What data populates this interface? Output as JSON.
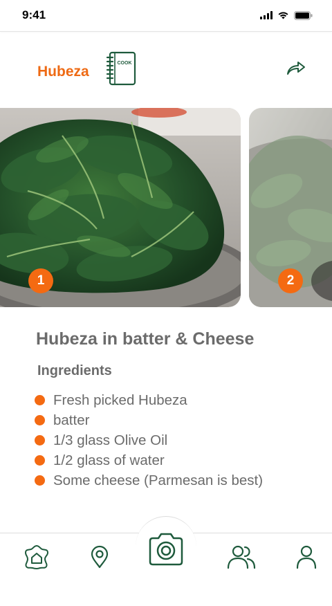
{
  "status_bar": {
    "time": "9:41",
    "icons": [
      "signal-icon",
      "wifi-icon",
      "battery-icon"
    ]
  },
  "header": {
    "title": "Hubeza",
    "cookbook_label": "COOK",
    "share_icon": "share-icon"
  },
  "carousel": {
    "slides": [
      {
        "badge": "1",
        "image": "boiled hubeza leaves in colander"
      },
      {
        "badge": "2",
        "image": "hubeza leaves boiling in pot"
      }
    ]
  },
  "recipe": {
    "title": "Hubeza in batter & Cheese",
    "section_heading": "Ingredients",
    "ingredients": [
      "Fresh picked Hubeza",
      "batter",
      "1/3 glass Olive Oil",
      "1/2 glass of water",
      "Some cheese (Parmesan is best)"
    ]
  },
  "tab_bar": {
    "items": [
      "home-icon",
      "location-pin-icon",
      "camera-icon",
      "community-icon",
      "profile-icon"
    ]
  },
  "colors": {
    "accent": "#ee6a14",
    "badge": "#f46a12",
    "icon_green": "#1e5a3c",
    "text_gray": "#6b6b6b"
  }
}
